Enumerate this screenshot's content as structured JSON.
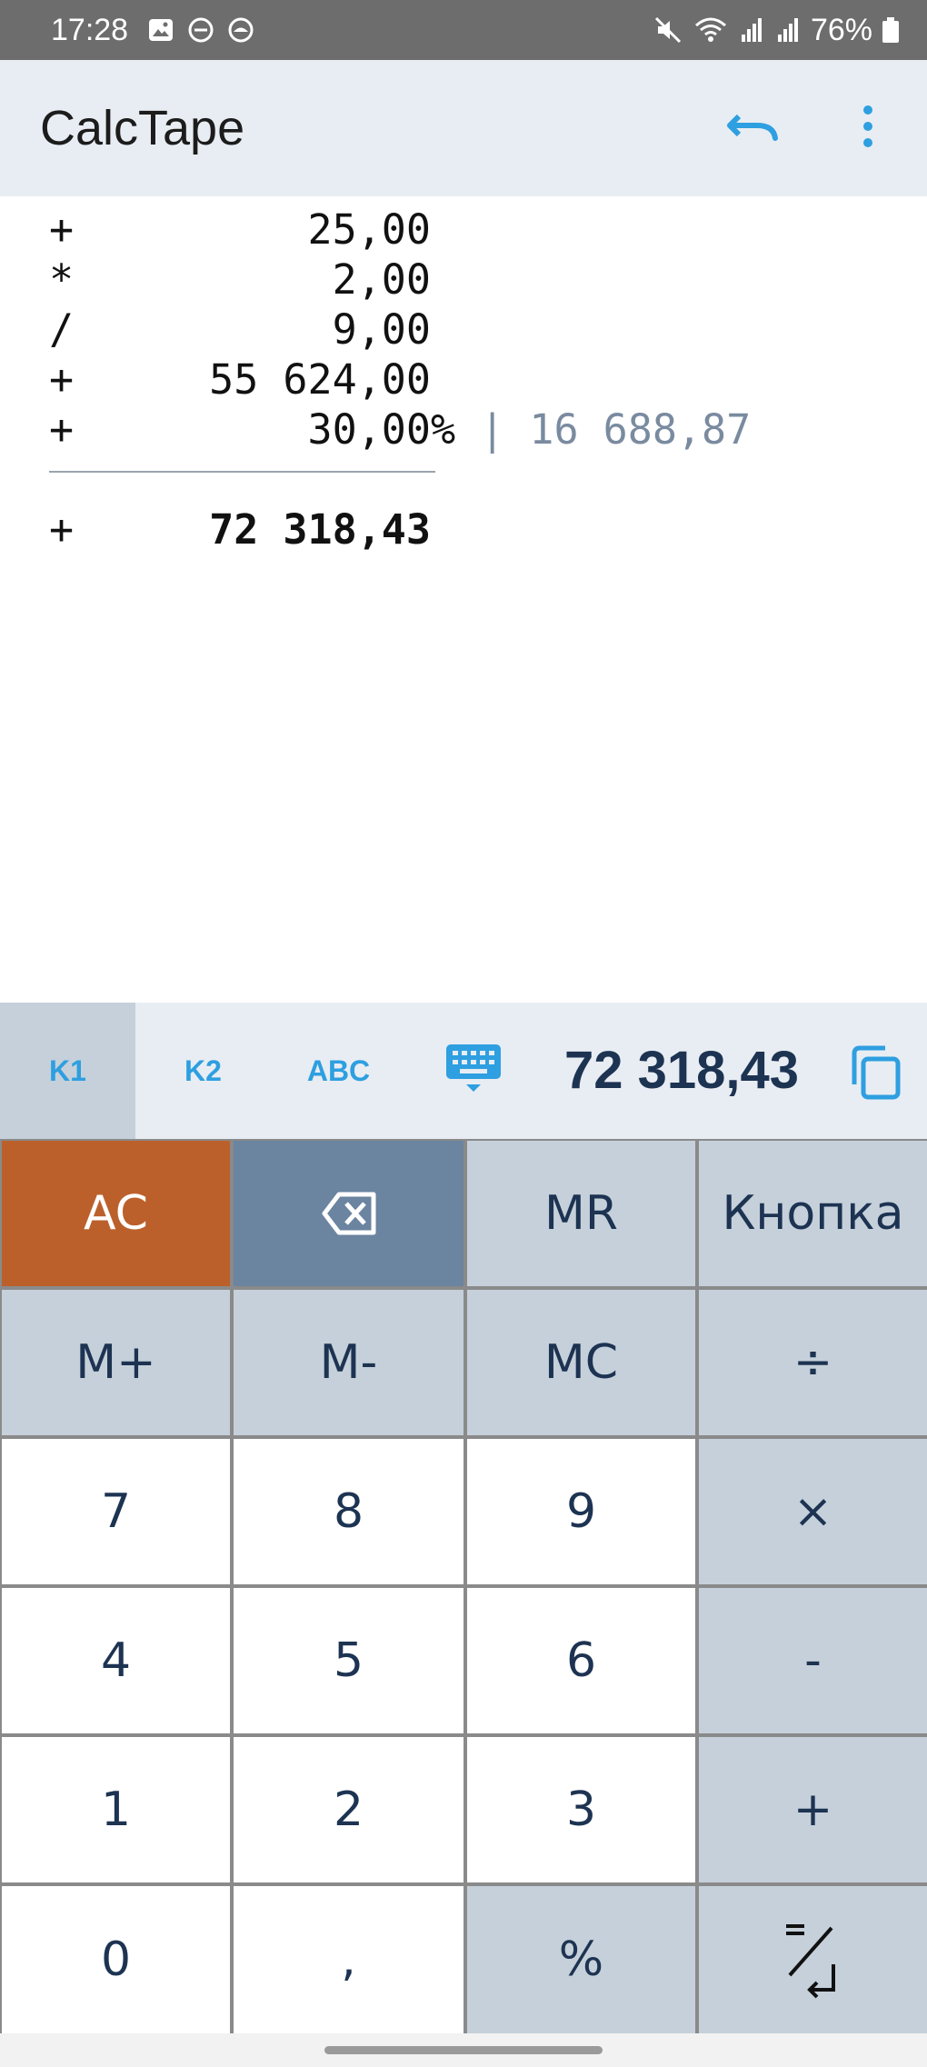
{
  "status_bar": {
    "time": "17:28",
    "battery": "76%"
  },
  "app": {
    "title": "CalcTape"
  },
  "tape": {
    "rows": [
      {
        "op": "+",
        "value": "25,00"
      },
      {
        "op": "*",
        "value": "2,00"
      },
      {
        "op": "/",
        "value": "9,00"
      },
      {
        "op": "+",
        "value": "55 624,00"
      },
      {
        "op": "+",
        "value": "30,00",
        "pct": "%",
        "extra": " | 16 688,87"
      }
    ],
    "result": {
      "op": "+",
      "value": "72 318,43"
    }
  },
  "mode_bar": {
    "tabs": [
      "K1",
      "K2",
      "ABC"
    ],
    "active_tab": "K1",
    "display": "72 318,43"
  },
  "keypad": {
    "ac": "AC",
    "mr": "MR",
    "custom": "Кнопка",
    "m_plus": "M+",
    "m_minus": "M-",
    "mc": "MC",
    "divide": "÷",
    "multiply": "×",
    "minus": "-",
    "plus": "+",
    "percent": "%",
    "comma": ",",
    "digits": [
      "0",
      "1",
      "2",
      "3",
      "4",
      "5",
      "6",
      "7",
      "8",
      "9"
    ]
  },
  "colors": {
    "accent": "#2e9fe0",
    "ac_key": "#bc602b",
    "backspace_key": "#6b84a0",
    "gray_key": "#c5d0da",
    "key_text": "#1d3352"
  }
}
